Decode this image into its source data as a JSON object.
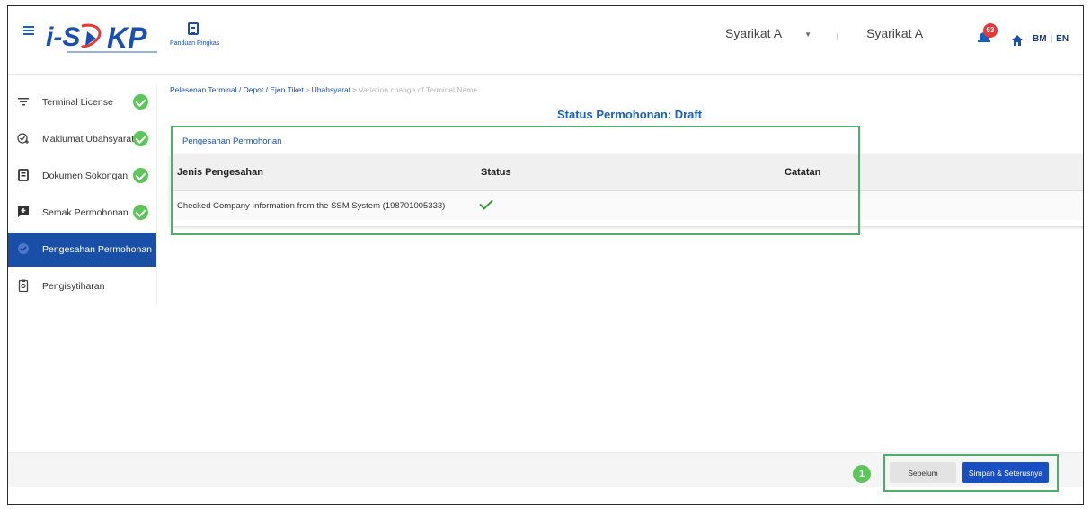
{
  "header": {
    "logo_alt": "iSPKP",
    "guide_label": "Panduan Ringkas",
    "company_select": "Syarikat A",
    "company_name": "Syarikat A",
    "notification_count": "63",
    "lang_bm": "BM",
    "lang_separator": "|",
    "lang_en": "EN"
  },
  "sidebar": {
    "items": [
      {
        "label": "Terminal License",
        "icon": "filter-icon",
        "completed": true
      },
      {
        "label": "Maklumat Ubahsyarat",
        "icon": "check-plus-icon",
        "completed": true
      },
      {
        "label": "Dokumen Sokongan",
        "icon": "document-icon",
        "completed": true
      },
      {
        "label": "Semak Permohonan",
        "icon": "review-icon",
        "completed": true
      },
      {
        "label": "Pengesahan Permohonan",
        "icon": "verify-icon",
        "completed": false,
        "active": true
      },
      {
        "label": "Pengisytiharan",
        "icon": "declaration-icon",
        "completed": false
      }
    ]
  },
  "breadcrumb": {
    "part1": "Pelesenan Terminal / Depot / Ejen Tiket",
    "sep": ">",
    "part2": "Ubahsyarat",
    "part3": "Variation change of Terminal Name"
  },
  "main": {
    "status_title": "Status Permohonan: Draft",
    "section_label": "Pengesahan Permohonan",
    "table": {
      "columns": [
        "Jenis Pengesahan",
        "Status",
        "Catatan"
      ],
      "rows": [
        {
          "type": "Checked Company Information from the SSM System (198701005333)",
          "status": "check",
          "note": ""
        }
      ]
    }
  },
  "footer": {
    "prev_label": "Sebelum",
    "next_label": "Simpan & Seterusnya",
    "step_number": "1"
  },
  "colors": {
    "primary": "#1a4fa8",
    "accent_blue": "#1a5fbf",
    "success": "#5ec55b",
    "highlight": "#4cae6a",
    "badge": "#e53935"
  }
}
